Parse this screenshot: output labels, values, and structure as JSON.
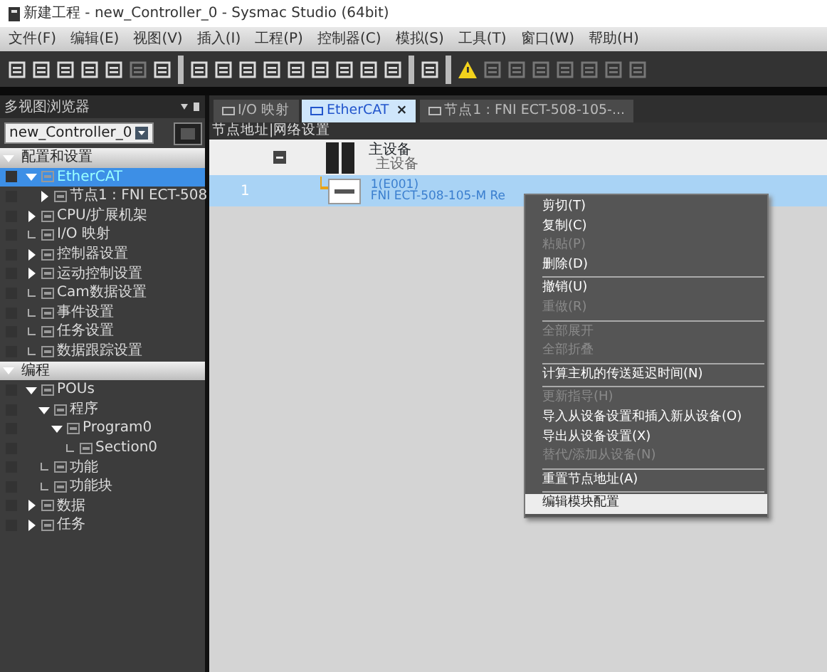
{
  "window": {
    "title": "新建工程 - new_Controller_0 - Sysmac Studio (64bit)"
  },
  "menu_bar": [
    "文件(F)",
    "编辑(E)",
    "视图(V)",
    "插入(I)",
    "工程(P)",
    "控制器(C)",
    "模拟(S)",
    "工具(T)",
    "窗口(W)",
    "帮助(H)"
  ],
  "toolbar": [
    {
      "kind": "tool",
      "disabled": false
    },
    {
      "kind": "tool",
      "disabled": false
    },
    {
      "kind": "tool",
      "disabled": false
    },
    {
      "kind": "tool",
      "disabled": false
    },
    {
      "kind": "tool",
      "disabled": false
    },
    {
      "kind": "tool",
      "disabled": true
    },
    {
      "kind": "tool",
      "disabled": false
    },
    {
      "kind": "sep"
    },
    {
      "kind": "tool",
      "disabled": false
    },
    {
      "kind": "tool",
      "disabled": false
    },
    {
      "kind": "tool",
      "disabled": false
    },
    {
      "kind": "tool",
      "disabled": false
    },
    {
      "kind": "tool",
      "disabled": false
    },
    {
      "kind": "tool",
      "disabled": false
    },
    {
      "kind": "tool",
      "disabled": false
    },
    {
      "kind": "tool",
      "disabled": false
    },
    {
      "kind": "tool",
      "disabled": false
    },
    {
      "kind": "sep"
    },
    {
      "kind": "tool",
      "disabled": false
    },
    {
      "kind": "sep"
    },
    {
      "kind": "warning",
      "disabled": false
    },
    {
      "kind": "tool",
      "disabled": true
    },
    {
      "kind": "tool",
      "disabled": true
    },
    {
      "kind": "tool",
      "disabled": true
    },
    {
      "kind": "tool",
      "disabled": true
    },
    {
      "kind": "tool",
      "disabled": true
    },
    {
      "kind": "tool",
      "disabled": true
    },
    {
      "kind": "tool",
      "disabled": true
    }
  ],
  "sidebar": {
    "title": "多视图浏览器",
    "controller": "new_Controller_0",
    "tree": [
      {
        "label": "配置和设置",
        "kind": "section",
        "expanded": true,
        "children": [
          {
            "label": "EtherCAT",
            "selected": true,
            "expanded": true,
            "children": [
              {
                "label": "节点1 : FNI ECT-508",
                "selected": false,
                "expanded": false
              }
            ]
          },
          {
            "label": "CPU/扩展机架",
            "selected": false,
            "expanded": false
          },
          {
            "label": "I/O 映射",
            "selected": false
          },
          {
            "label": "控制器设置",
            "selected": false,
            "expanded": false
          },
          {
            "label": "运动控制设置",
            "selected": false,
            "expanded": false
          },
          {
            "label": "Cam数据设置",
            "selected": false
          },
          {
            "label": "事件设置",
            "selected": false
          },
          {
            "label": "任务设置",
            "selected": false
          },
          {
            "label": "数据跟踪设置",
            "selected": false
          }
        ]
      },
      {
        "label": "编程",
        "kind": "section",
        "expanded": true,
        "children": [
          {
            "label": "POUs",
            "selected": false,
            "expanded": true,
            "children": [
              {
                "label": "程序",
                "selected": false,
                "expanded": true,
                "children": [
                  {
                    "label": "Program0",
                    "selected": false,
                    "expanded": true,
                    "children": [
                      {
                        "label": "Section0",
                        "selected": false
                      }
                    ]
                  }
                ]
              },
              {
                "label": "功能",
                "selected": false
              },
              {
                "label": "功能块",
                "selected": false
              }
            ]
          },
          {
            "label": "数据",
            "selected": false,
            "expanded": false
          },
          {
            "label": "任务",
            "selected": false,
            "expanded": false
          }
        ]
      }
    ]
  },
  "tabs": [
    {
      "label": "I/O 映射",
      "selected": false
    },
    {
      "label": "EtherCAT",
      "selected": true,
      "close": "×"
    },
    {
      "label": "节点1 : FNI ECT-508-105-...",
      "selected": false
    }
  ],
  "editor": {
    "header": "节点地址|网络设置",
    "master": {
      "label": "主设备",
      "sublabel": "主设备"
    },
    "slave": {
      "index": "1",
      "address": "1(E001)",
      "name": "FNI ECT-508-105-M Re",
      "selected": true
    }
  },
  "context_menu": [
    {
      "kind": "item",
      "label": "剪切(T)",
      "disabled": false,
      "selected": false
    },
    {
      "kind": "item",
      "label": "复制(C)",
      "disabled": false,
      "selected": false
    },
    {
      "kind": "item",
      "label": "粘贴(P)",
      "disabled": true,
      "selected": false
    },
    {
      "kind": "item",
      "label": "删除(D)",
      "disabled": false,
      "selected": false
    },
    {
      "kind": "separator"
    },
    {
      "kind": "item",
      "label": "撤销(U)",
      "disabled": false,
      "selected": false
    },
    {
      "kind": "item",
      "label": "重做(R)",
      "disabled": true,
      "selected": false
    },
    {
      "kind": "separator"
    },
    {
      "kind": "item",
      "label": "全部展开",
      "disabled": true,
      "selected": false
    },
    {
      "kind": "item",
      "label": "全部折叠",
      "disabled": true,
      "selected": false
    },
    {
      "kind": "separator"
    },
    {
      "kind": "item",
      "label": "计算主机的传送延迟时间(N)",
      "disabled": false,
      "selected": false
    },
    {
      "kind": "separator"
    },
    {
      "kind": "item",
      "label": "更新指导(H)",
      "disabled": true,
      "selected": false
    },
    {
      "kind": "item",
      "label": "导入从设备设置和插入新从设备(O)",
      "disabled": false,
      "selected": false
    },
    {
      "kind": "item",
      "label": "导出从设备设置(X)",
      "disabled": false,
      "selected": false
    },
    {
      "kind": "item",
      "label": "替代/添加从设备(N)",
      "disabled": true,
      "selected": false
    },
    {
      "kind": "separator"
    },
    {
      "kind": "item",
      "label": "重置节点地址(A)",
      "disabled": false,
      "selected": false
    },
    {
      "kind": "separator"
    },
    {
      "kind": "item",
      "label": "编辑模块配置",
      "disabled": false,
      "selected": true
    }
  ]
}
